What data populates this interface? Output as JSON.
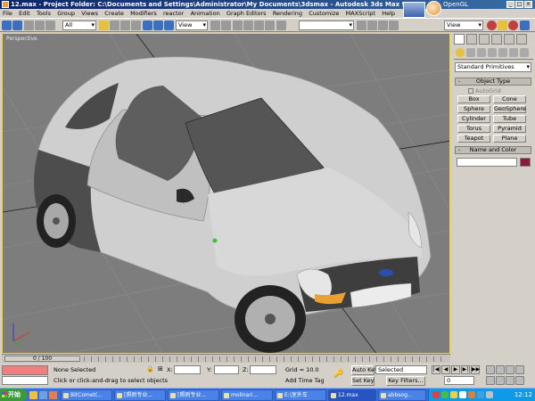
{
  "window": {
    "title": "12.max - Project Folder: C:\\Documents and Settings\\Administrator\\My Documents\\3dsmax - Autodesk 3ds Max 9",
    "renderer_label": "OpenGL"
  },
  "menu": [
    "File",
    "Edit",
    "Tools",
    "Group",
    "Views",
    "Create",
    "Modifiers",
    "reactor",
    "Animation",
    "Graph Editors",
    "Rendering",
    "Customize",
    "MAXScript",
    "Help"
  ],
  "toolbar": {
    "selection_filter": "All",
    "reference_coord": "View",
    "named_selection": "",
    "view_dropdown": "View"
  },
  "viewport": {
    "label": "Perspective"
  },
  "command_panel": {
    "category": "Standard Primitives",
    "object_type_title": "Object Type",
    "autogrid_label": "AutoGrid",
    "primitives": [
      "Box",
      "Cone",
      "Sphere",
      "GeoSphere",
      "Cylinder",
      "Tube",
      "Torus",
      "Pyramid",
      "Teapot",
      "Plane"
    ],
    "name_color_title": "Name and Color",
    "swatch_color": "#8c1a3a"
  },
  "timeline": {
    "slider_label": "0 / 100"
  },
  "status": {
    "selection_text": "None Selected",
    "prompt_text": "Click or click-and-drag to select objects",
    "x_label": "X:",
    "y_label": "Y:",
    "z_label": "Z:",
    "grid_text": "Grid = 10.0",
    "add_time_tag": "Add Time Tag",
    "auto_key": "Auto Key",
    "set_key": "Set Key",
    "key_mode": "Selected",
    "key_filters": "Key Filters...",
    "frame_value": "0"
  },
  "taskbar": {
    "start_label": "开始",
    "tasks": [
      "BitComet(...",
      "[照例专业...",
      "[照例专业...",
      "molinari...",
      "E:\\室外车",
      "12.max",
      "abbsog..."
    ],
    "clock": "12:12"
  }
}
